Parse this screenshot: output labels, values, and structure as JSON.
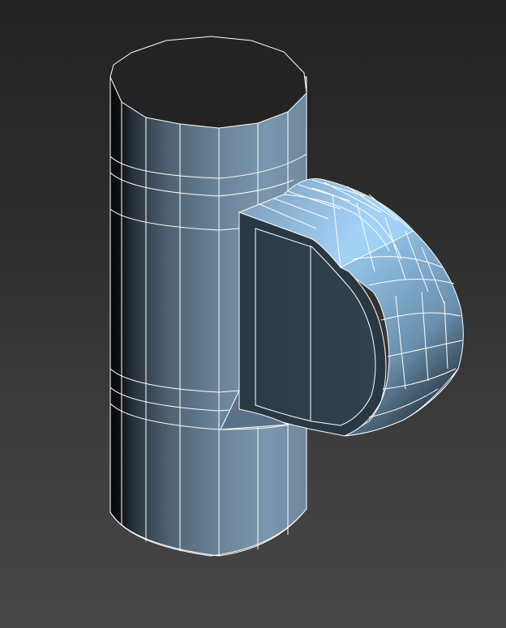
{
  "viewport": {
    "background_top": "#222222",
    "background_bottom": "#464646"
  },
  "object": {
    "kind": "tee-pipe-fitting",
    "display_mode": "shaded-with-edged-faces",
    "wire_color": "#ffffff",
    "surface_light": "#a9d8ff",
    "surface_mid": "#6d8aa3",
    "surface_dark": "#0d1014",
    "cap_color": "#232323"
  }
}
